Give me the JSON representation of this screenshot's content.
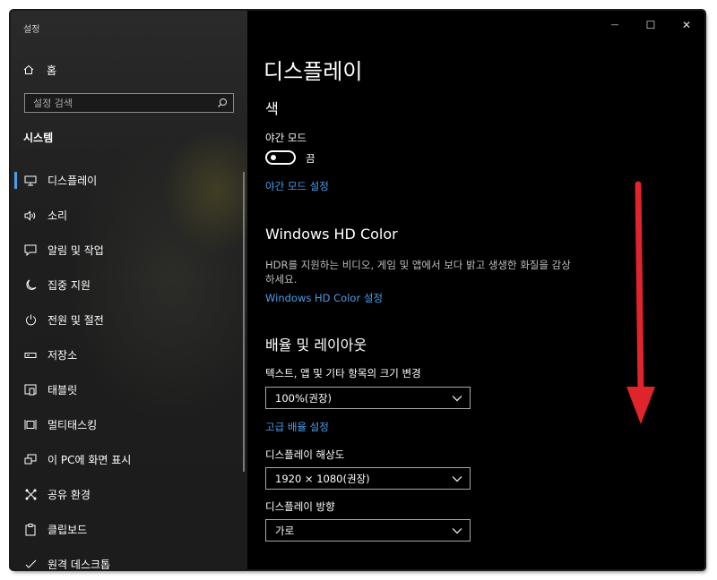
{
  "window": {
    "app_title": "설정",
    "controls": {
      "minimize": "—",
      "maximize": "☐",
      "close": "✕"
    }
  },
  "sidebar": {
    "home_label": "홈",
    "search": {
      "placeholder": "설정 검색"
    },
    "section_title": "시스템",
    "items": [
      {
        "label": "디스플레이",
        "icon": "monitor-icon",
        "active": true
      },
      {
        "label": "소리",
        "icon": "speaker-icon"
      },
      {
        "label": "알림 및 작업",
        "icon": "notification-icon"
      },
      {
        "label": "집중 지원",
        "icon": "moon-icon"
      },
      {
        "label": "전원 및 절전",
        "icon": "power-icon"
      },
      {
        "label": "저장소",
        "icon": "storage-icon"
      },
      {
        "label": "태블릿",
        "icon": "tablet-icon"
      },
      {
        "label": "멀티태스킹",
        "icon": "multitasking-icon"
      },
      {
        "label": "이 PC에 화면 표시",
        "icon": "project-icon"
      },
      {
        "label": "공유 환경",
        "icon": "share-icon"
      },
      {
        "label": "클립보드",
        "icon": "clipboard-icon"
      },
      {
        "label": "원격 데스크톱",
        "icon": "remote-desktop-icon"
      }
    ]
  },
  "main": {
    "page_title": "디스플레이",
    "color_section": {
      "title": "색",
      "night_light_label": "야간 모드",
      "toggle_state": "끔",
      "night_light_link": "야간 모드 설정"
    },
    "hd_color": {
      "title": "Windows HD Color",
      "desc_line1": "HDR를 지원하는 비디오, 게임 및 앱에서 보다 밝고 생생한 화질을 감상",
      "desc_line2": "하세요.",
      "link": "Windows HD Color 설정"
    },
    "scale_layout": {
      "title": "배율 및 레이아웃",
      "scale_label": "텍스트, 앱 및 기타 항목의 크기 변경",
      "scale_value": "100%(권장)",
      "advanced_link": "고급 배율 설정",
      "resolution_label": "디스플레이 해상도",
      "resolution_value": "1920 × 1080(권장)",
      "orientation_label": "디스플레이 방향",
      "orientation_value": "가로"
    }
  },
  "colors": {
    "accent": "#4c9ce8",
    "annotation_arrow": "#e0242b"
  }
}
